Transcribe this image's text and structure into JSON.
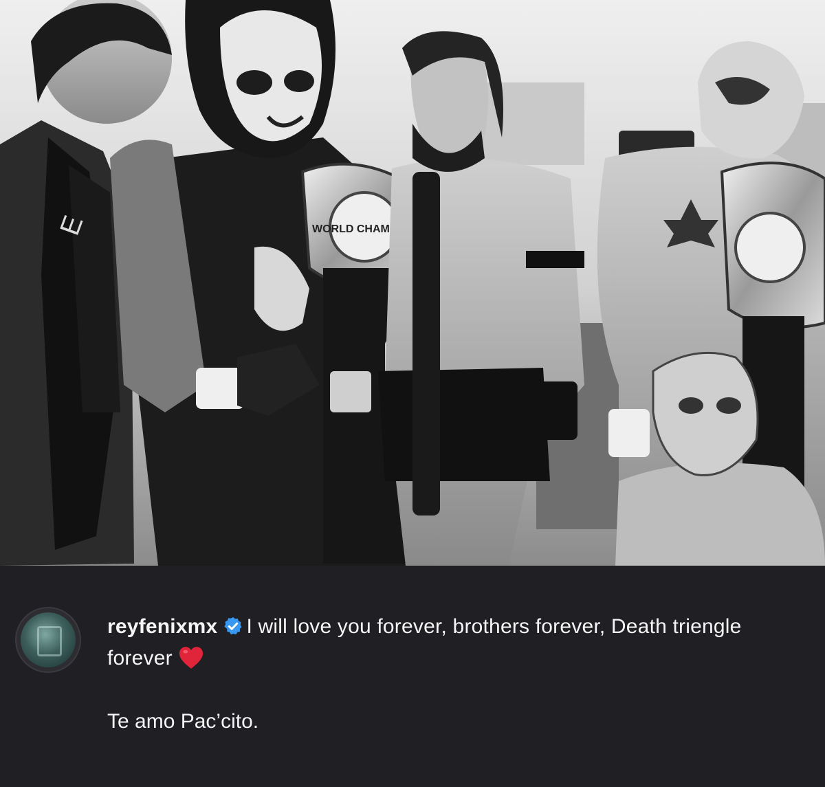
{
  "post": {
    "photo_alt": "Black and white photo of four wrestlers holding championship belts backstage",
    "photo_belt_text": "WORLD CHAMPION"
  },
  "caption": {
    "username": "reyfenixmx",
    "verified_icon": "verified-badge",
    "text": "I will love you forever, brothers forever, Death triengle forever",
    "emoji": "red-heart",
    "second_paragraph": "Te amo Pac’cito."
  },
  "colors": {
    "background": "#1f1f24",
    "verified": "#3897f0",
    "heart": "#e0253a"
  }
}
